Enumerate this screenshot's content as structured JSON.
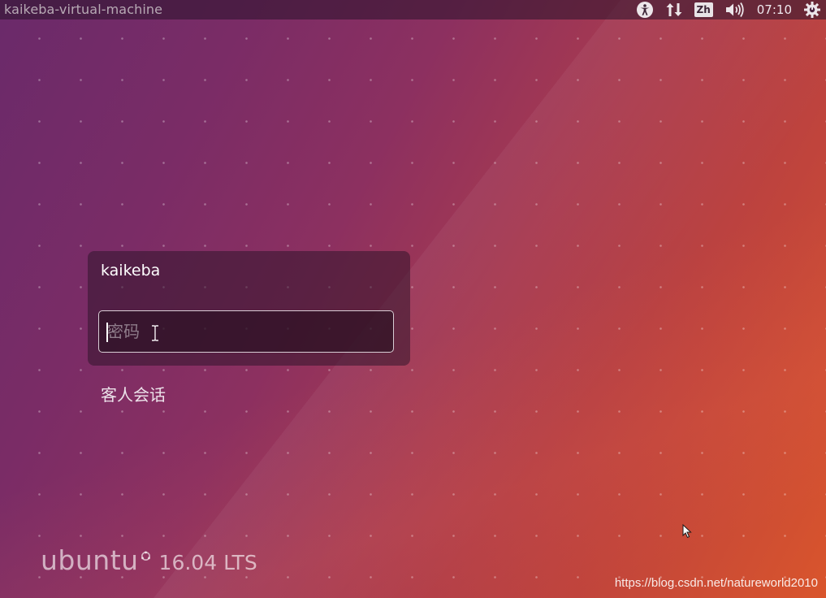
{
  "topbar": {
    "hostname": "kaikeba-virtual-machine",
    "indicators": {
      "accessibility_icon": "accessibility-icon",
      "network_icon": "network-updown-icon",
      "input_method": "Zh",
      "volume_icon": "volume-icon",
      "clock": "07:10",
      "power_icon": "power-gear-icon"
    }
  },
  "login": {
    "username": "kaikeba",
    "password_value": "",
    "password_placeholder": "密码",
    "guest_session_label": "客人会话"
  },
  "branding": {
    "wordmark": "ubuntu",
    "version": "16.04 LTS"
  },
  "watermark": "https://blog.csdn.net/natureworld2010",
  "colors": {
    "background_start": "#6a2a6a",
    "background_end": "#d9552c",
    "text": "#ffffff"
  }
}
